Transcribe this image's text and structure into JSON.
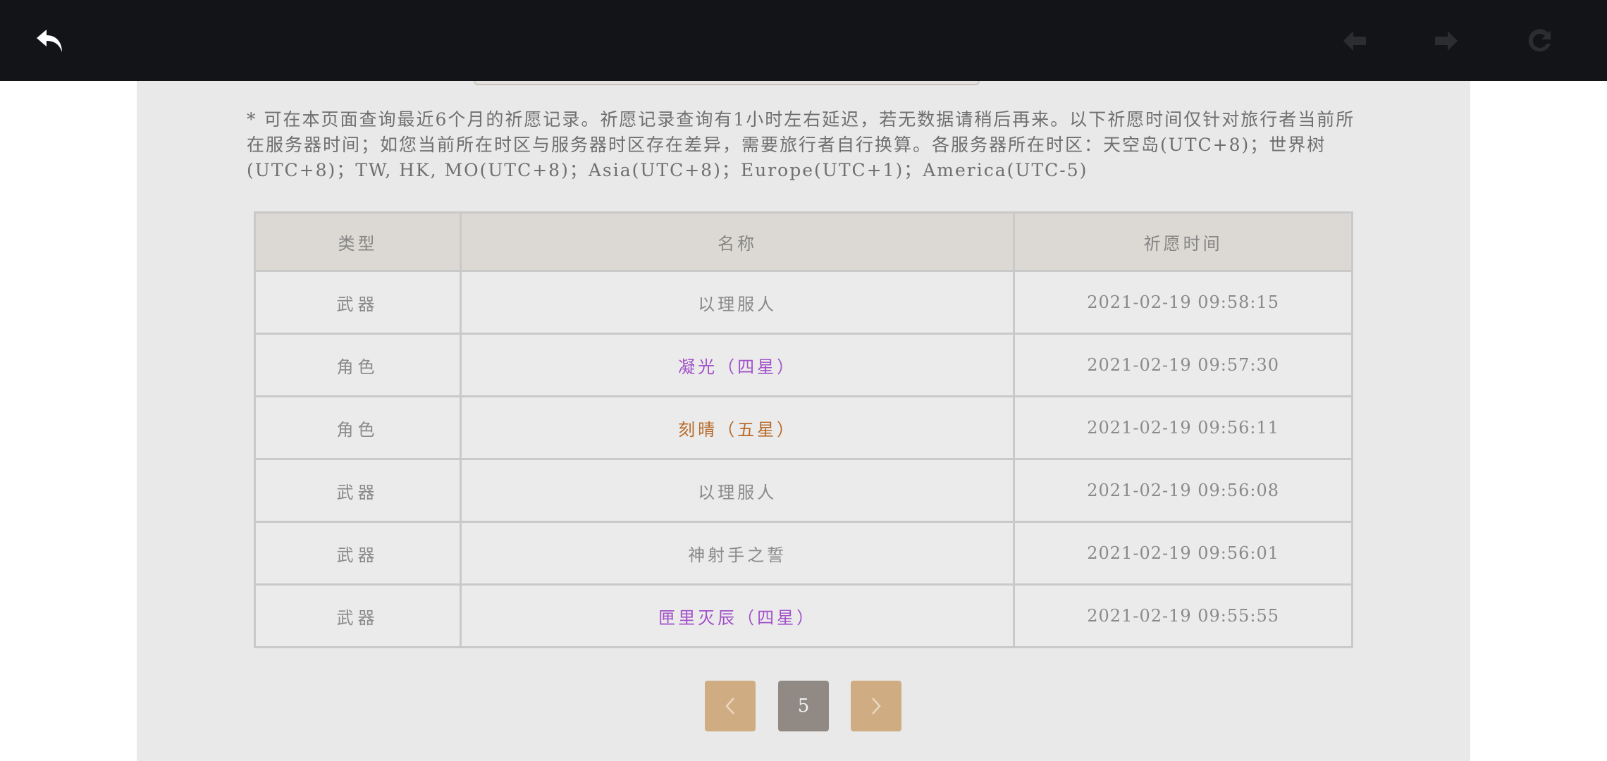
{
  "toolbar": {
    "back_icon": "back-arrow-icon",
    "prev_icon": "chevron-left-icon",
    "next_icon": "chevron-right-icon",
    "reload_icon": "reload-icon",
    "background": "#131418"
  },
  "notice": "* 可在本页面查询最近6个月的祈愿记录。祈愿记录查询有1小时左右延迟，若无数据请稍后再来。以下祈愿时间仅针对旅行者当前所在服务器时间；如您当前所在时区与服务器时区存在差异，需要旅行者自行换算。各服务器所在时区：天空岛(UTC+8)；世界树(UTC+8)；TW, HK, MO(UTC+8)；Asia(UTC+8)；Europe(UTC+1)；America(UTC-5)",
  "table": {
    "headers": {
      "type": "类型",
      "name": "名称",
      "time": "祈愿时间"
    },
    "rows": [
      {
        "type": "武器",
        "name": "以理服人",
        "rarity": "normal",
        "time": "2021-02-19 09:58:15"
      },
      {
        "type": "角色",
        "name": "凝光（四星）",
        "rarity": "four",
        "time": "2021-02-19 09:57:30"
      },
      {
        "type": "角色",
        "name": "刻晴（五星）",
        "rarity": "five",
        "time": "2021-02-19 09:56:11"
      },
      {
        "type": "武器",
        "name": "以理服人",
        "rarity": "normal",
        "time": "2021-02-19 09:56:08"
      },
      {
        "type": "武器",
        "name": "神射手之誓",
        "rarity": "normal",
        "time": "2021-02-19 09:56:01"
      },
      {
        "type": "武器",
        "name": "匣里灭辰（四星）",
        "rarity": "four",
        "time": "2021-02-19 09:55:55"
      }
    ]
  },
  "colors": {
    "four_star": "#a252c9",
    "five_star": "#b86b2a",
    "pager_button": "#d0ac83",
    "pager_current": "#918a84"
  },
  "pagination": {
    "current_page": "5",
    "prev_icon": "chevron-left-icon",
    "next_icon": "chevron-right-icon"
  }
}
